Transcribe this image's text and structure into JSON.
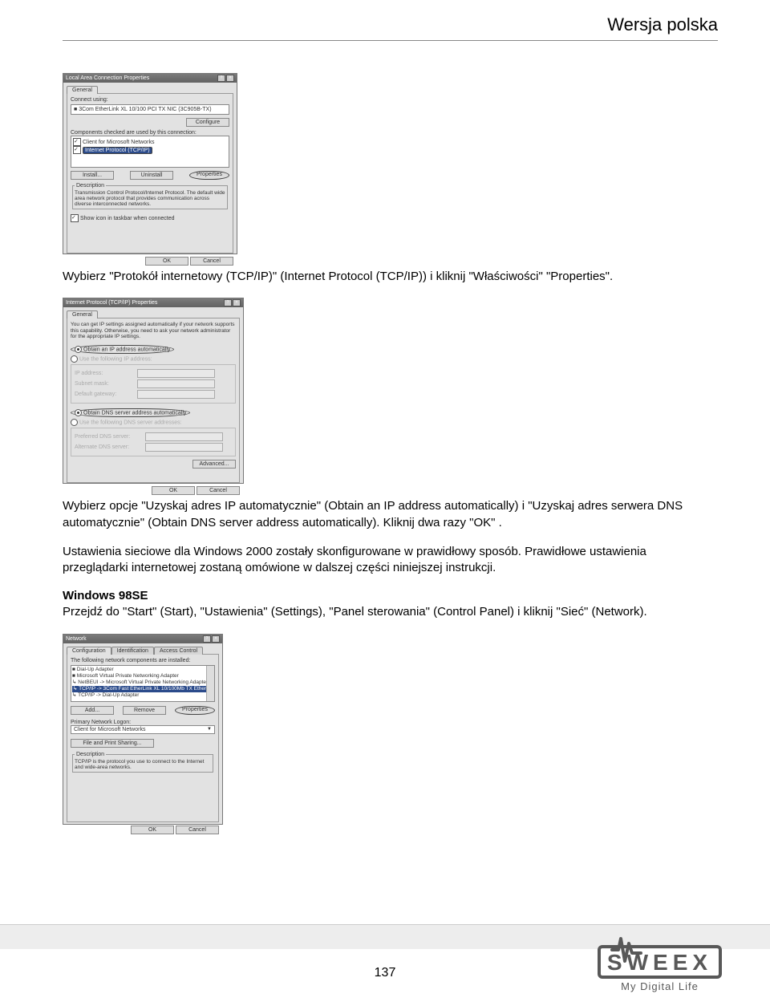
{
  "header": {
    "title": "Wersja polska"
  },
  "ss1": {
    "title": "Local Area Connection Properties",
    "tab": "General",
    "connect_using_label": "Connect using:",
    "adapter": "3Com EtherLink XL 10/100 PCI TX NIC (3C905B-TX)",
    "configure_btn": "Configure",
    "components_label": "Components checked are used by this connection:",
    "item1": "Client for Microsoft Networks",
    "item2": "Internet Protocol (TCP/IP)",
    "install_btn": "Install...",
    "uninstall_btn": "Uninstall",
    "properties_btn": "Properties",
    "desc_label": "Description",
    "desc_text": "Transmission Control Protocol/Internet Protocol. The default wide area network protocol that provides communication across diverse interconnected networks.",
    "show_icon": "Show icon in taskbar when connected",
    "ok": "OK",
    "cancel": "Cancel"
  },
  "para1": "Wybierz \"Protokół internetowy (TCP/IP)\" (Internet Protocol (TCP/IP)) i kliknij \"Właściwości\" \"Properties\".",
  "ss2": {
    "title": "Internet Protocol (TCP/IP) Properties",
    "tab": "General",
    "intro": "You can get IP settings assigned automatically if your network supports this capability. Otherwise, you need to ask your network administrator for the appropriate IP settings.",
    "opt_auto_ip": "Obtain an IP address automatically",
    "opt_use_ip": "Use the following IP address:",
    "ip_label": "IP address:",
    "mask_label": "Subnet mask:",
    "gw_label": "Default gateway:",
    "opt_auto_dns": "Obtain DNS server address automatically",
    "opt_use_dns": "Use the following DNS server addresses:",
    "pref_dns": "Preferred DNS server:",
    "alt_dns": "Alternate DNS server:",
    "advanced_btn": "Advanced...",
    "ok": "OK",
    "cancel": "Cancel"
  },
  "para2": "Wybierz opcje \"Uzyskaj adres IP automatycznie\" (Obtain an IP address automatically) i \"Uzyskaj adres serwera DNS automatycznie\" (Obtain DNS server address automatically). Kliknij dwa razy \"OK\" .",
  "para3": "Ustawienia sieciowe dla Windows 2000 zostały skonfigurowane w prawidłowy sposób. Prawidłowe ustawienia przeglądarki internetowej zostaną omówione w dalszej części niniejszej instrukcji.",
  "sec_win98": {
    "heading": "Windows 98SE",
    "text": "Przejdź do \"Start\" (Start), \"Ustawienia\" (Settings), \"Panel sterowania\" (Control Panel) i kliknij \"Sieć\" (Network)."
  },
  "ss3": {
    "title": "Network",
    "tab1": "Configuration",
    "tab2": "Identification",
    "tab3": "Access Control",
    "list_label": "The following network components are installed:",
    "items": [
      "Dial-Up Adapter",
      "Microsoft Virtual Private Networking Adapter",
      "NetBEUI -> Microsoft Virtual Private Networking Adapter",
      "TCP/IP -> 3Com Fast EtherLink XL 10/100Mb TX Ether",
      "TCP/IP -> Dial-Up Adapter"
    ],
    "add_btn": "Add...",
    "remove_btn": "Remove",
    "properties_btn": "Properties",
    "logon_label": "Primary Network Logon:",
    "logon_value": "Client for Microsoft Networks",
    "fps_btn": "File and Print Sharing...",
    "desc_label": "Description",
    "desc_text": "TCP/IP is the protocol you use to connect to the Internet and wide-area networks.",
    "ok": "OK",
    "cancel": "Cancel"
  },
  "footer": {
    "pagenum": "137",
    "brand": "SWEEX",
    "tagline": "My Digital Life"
  }
}
